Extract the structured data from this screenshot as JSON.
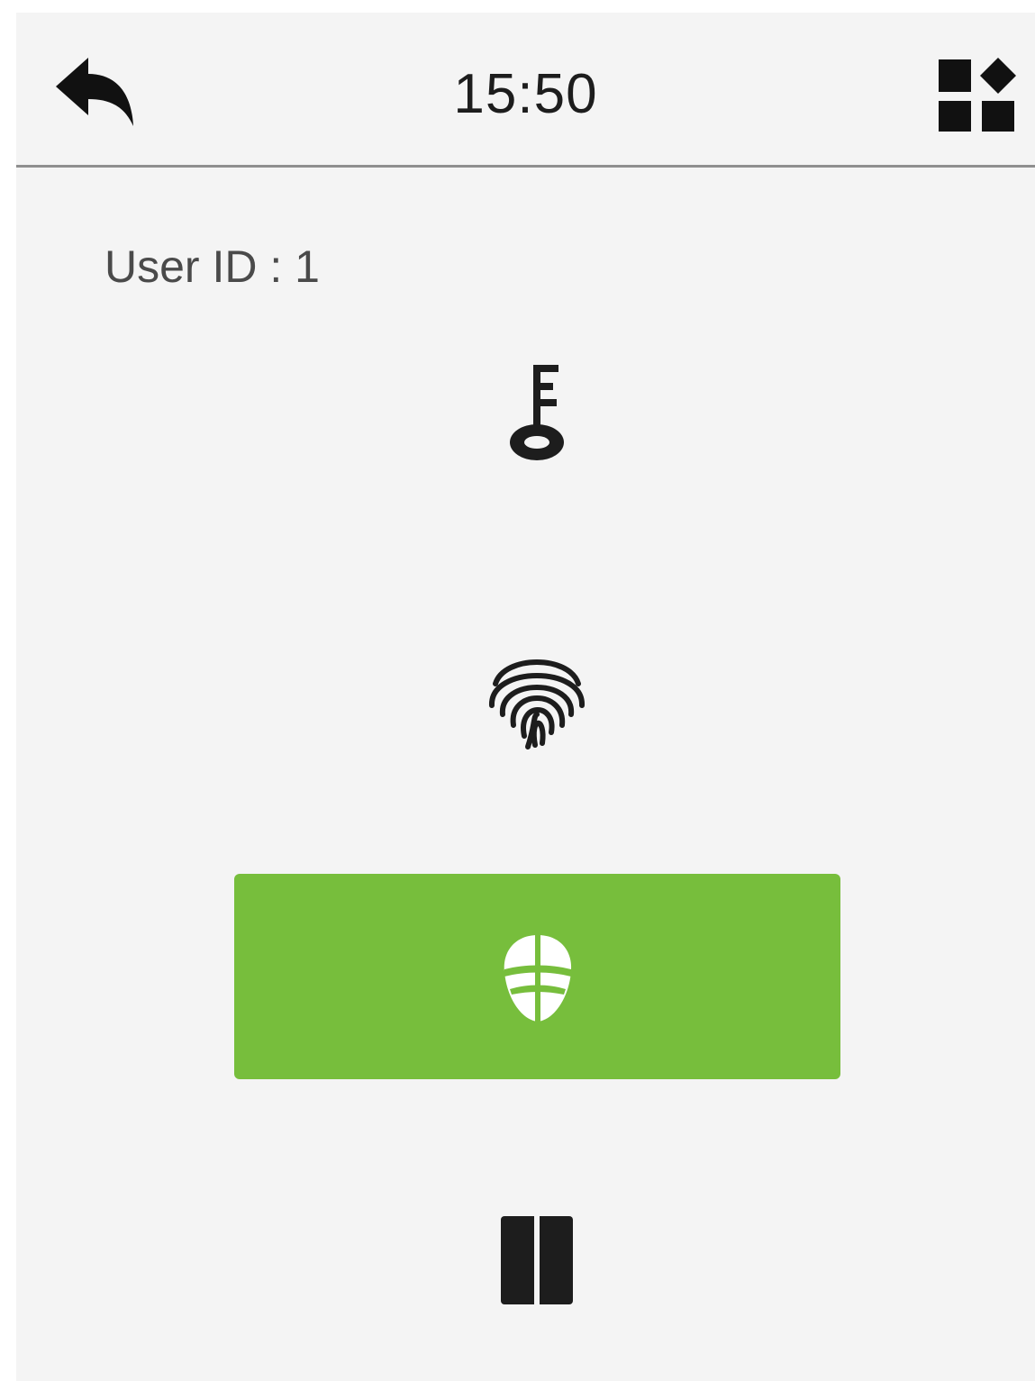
{
  "header": {
    "time": "15:50",
    "back_icon": "back-arrow-icon",
    "menu_icon": "grid-menu-icon"
  },
  "user": {
    "id_label": "User ID : 1"
  },
  "verification_methods": [
    {
      "name": "password",
      "icon": "key-icon",
      "selected": false
    },
    {
      "name": "fingerprint",
      "icon": "fingerprint-icon",
      "selected": false
    },
    {
      "name": "face",
      "icon": "face-icon",
      "selected": true
    },
    {
      "name": "card",
      "icon": "card-icon",
      "selected": false
    }
  ],
  "colors": {
    "background": "#f4f4f4",
    "selected": "#77be3c",
    "icon": "#1d1d1d",
    "divider": "#8f8f8f"
  }
}
